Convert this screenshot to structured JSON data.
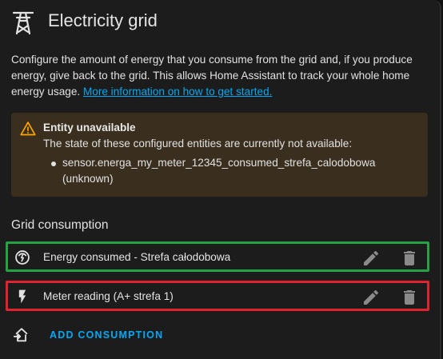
{
  "header": {
    "title": "Electricity grid",
    "icon": "transmission-tower-icon"
  },
  "description": {
    "text": "Configure the amount of energy that you consume from the grid and, if you produce energy, give back to the grid. This allows Home Assistant to track your whole home energy usage.",
    "link_text": "More information on how to get started."
  },
  "alert": {
    "icon": "warning-icon",
    "title": "Entity unavailable",
    "text": "The state of these configured entities are currently not available:",
    "items": [
      "sensor.energa_my_meter_12345_consumed_strefa_calodobowa (unknown)"
    ]
  },
  "grid_consumption": {
    "title": "Grid consumption",
    "rows": [
      {
        "label": "Energy consumed - Strefa całodobowa",
        "icon": "meter-icon",
        "highlight": "#25a244"
      },
      {
        "label": "Meter reading (A+ strefa 1)",
        "icon": "lightning-bolt-icon",
        "highlight": "#e0232f"
      }
    ],
    "add_label": "ADD CONSUMPTION"
  },
  "colors": {
    "background": "#1c1c1c",
    "accent": "#03a9f4",
    "warning": "#ffa600",
    "alert_background": "#3a2f1f"
  }
}
